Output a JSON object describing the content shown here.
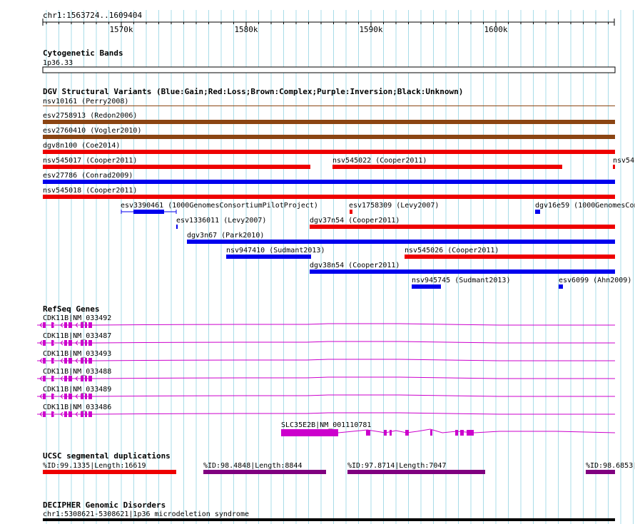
{
  "region": "chr1:1563724..1609404",
  "ruler": {
    "ticks": [
      "1570k",
      "1580k",
      "1590k",
      "1600k"
    ]
  },
  "tracks": {
    "cytoband": {
      "title": "Cytogenetic Bands",
      "band_label": "1p36.33"
    },
    "dgv": {
      "title": "DGV Structural Variants (Blue:Gain;Red:Loss;Brown:Complex;Purple:Inversion;Black:Unknown)",
      "legend_colors": {
        "gain": "#0000ee",
        "loss": "#ee0000",
        "complex": "#8b4513",
        "inversion": "#800080",
        "unknown": "#000000"
      },
      "features": [
        {
          "label": "nsv10161 (Perry2008)",
          "type": "complex",
          "thin": true
        },
        {
          "label": "esv2758913 (Redon2006)",
          "type": "complex"
        },
        {
          "label": "esv2760410 (Vogler2010)",
          "type": "complex"
        },
        {
          "label": "dgv8n100 (Coe2014)",
          "type": "loss"
        },
        {
          "label": "nsv545017 (Cooper2011)",
          "type": "loss"
        },
        {
          "label": "nsv545022 (Cooper2011)",
          "type": "loss"
        },
        {
          "label": "nsv54",
          "type": "loss"
        },
        {
          "label": "esv27786 (Conrad2009)",
          "type": "gain"
        },
        {
          "label": "nsv545018 (Cooper2011)",
          "type": "loss"
        },
        {
          "label": "esv3390461 (1000GenomesConsortiumPilotProject)",
          "type": "gain"
        },
        {
          "label": "esv1758309 (Levy2007)",
          "type": "loss"
        },
        {
          "label": "dgv16e59 (1000GenomesCon",
          "type": "gain"
        },
        {
          "label": "esv1336011 (Levy2007)",
          "type": "gain"
        },
        {
          "label": "dgv37n54 (Cooper2011)",
          "type": "loss"
        },
        {
          "label": "dgv3n67 (Park2010)",
          "type": "gain"
        },
        {
          "label": "nsv947410 (Sudmant2013)",
          "type": "gain"
        },
        {
          "label": "nsv545026 (Cooper2011)",
          "type": "loss"
        },
        {
          "label": "dgv38n54 (Cooper2011)",
          "type": "gain"
        },
        {
          "label": "nsv945745 (Sudmant2013)",
          "type": "gain"
        },
        {
          "label": "esv6099 (Ahn2009)",
          "type": "gain"
        }
      ]
    },
    "refseq": {
      "title": "RefSeq Genes",
      "color": "#cc00cc",
      "transcripts": [
        {
          "label": "CDK11B|NM_033492"
        },
        {
          "label": "CDK11B|NM_033487"
        },
        {
          "label": "CDK11B|NM_033493"
        },
        {
          "label": "CDK11B|NM_033488"
        },
        {
          "label": "CDK11B|NM_033489"
        },
        {
          "label": "CDK11B|NM_033486"
        },
        {
          "label": "SLC35E2B|NM_001110781"
        }
      ]
    },
    "segdup": {
      "title": "UCSC segmental duplications",
      "features": [
        {
          "label": "%ID:99.1335|Length:16619",
          "color": "#ee0000"
        },
        {
          "label": "%ID:98.4848|Length:8844",
          "color": "#800080"
        },
        {
          "label": "%ID:97.8714|Length:7047",
          "color": "#800080"
        },
        {
          "label": "%ID:98.6853|",
          "color": "#800080"
        }
      ]
    },
    "decipher": {
      "title": "DECIPHER Genomic Disorders",
      "features": [
        {
          "label": "chr1:5308621-5308621|1p36 microdeletion syndrome",
          "color": "#000000"
        }
      ]
    }
  }
}
